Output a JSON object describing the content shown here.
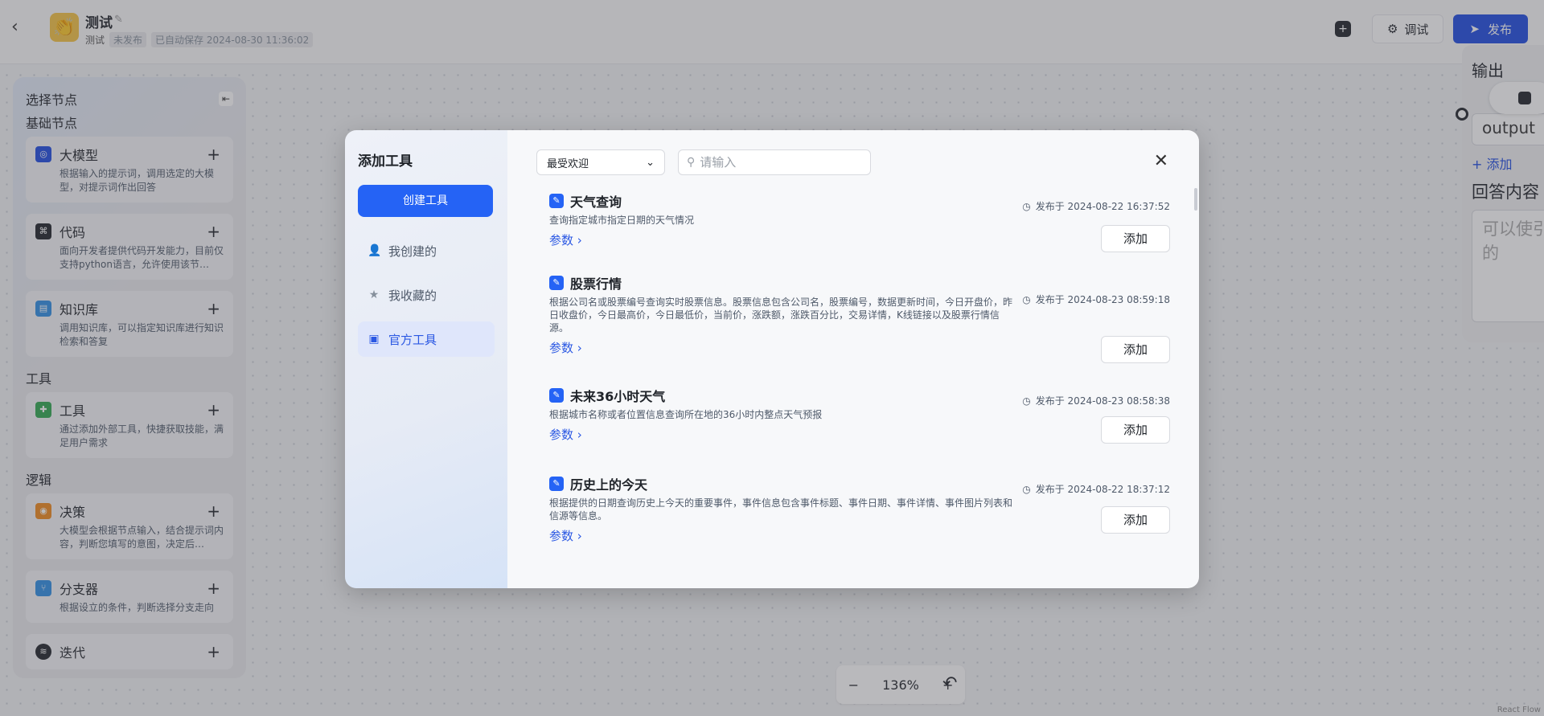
{
  "header": {
    "app_name": "测试",
    "app_desc": "测试",
    "status": "未发布",
    "autosave": "已自动保存 2024-08-30 11:36:02",
    "debug_label": "调试",
    "publish_label": "发布"
  },
  "node_panel": {
    "title": "选择节点",
    "section_basic": "基础节点",
    "section_tools": "工具",
    "section_logic": "逻辑",
    "nodes": [
      {
        "name": "大模型",
        "desc": "根据输入的提示词，调用选定的大模型，对提示词作出回答",
        "color": "#1e4be3"
      },
      {
        "name": "代码",
        "desc": "面向开发者提供代码开发能力，目前仅支持python语言，允许使用该节…",
        "color": "#1f2329"
      },
      {
        "name": "知识库",
        "desc": "调用知识库，可以指定知识库进行知识检索和答复",
        "color": "#2e8ee6"
      },
      {
        "name": "工具",
        "desc": "通过添加外部工具，快捷获取技能，满足用户需求",
        "color": "#2fa84f"
      },
      {
        "name": "决策",
        "desc": "大模型会根据节点输入，结合提示词内容，判断您填写的意图，决定后…",
        "color": "#f08a1c"
      },
      {
        "name": "分支器",
        "desc": "根据设立的条件，判断选择分支走向",
        "color": "#2e8ee6"
      },
      {
        "name": "迭代",
        "desc": "",
        "color": "#1f2329"
      }
    ]
  },
  "right_panel": {
    "title": "输出",
    "field_value": "output",
    "add_label": "添加",
    "answer_label": "回答内容",
    "answer_placeholder": "可以使引}}的"
  },
  "zoom": {
    "minus": "−",
    "level": "136%",
    "plus": "+"
  },
  "canvas_label": "React Flow",
  "modal": {
    "title": "添加工具",
    "create_label": "创建工具",
    "nav": [
      {
        "label": "我创建的",
        "icon": "person-icon"
      },
      {
        "label": "我收藏的",
        "icon": "star-icon"
      },
      {
        "label": "官方工具",
        "icon": "briefcase-icon"
      }
    ],
    "sort_value": "最受欢迎",
    "search_placeholder": "请输入",
    "tools": [
      {
        "name": "天气查询",
        "desc": "查询指定城市指定日期的天气情况",
        "time": "发布于 2024-08-22 16:37:52",
        "params": "参数",
        "add": "添加"
      },
      {
        "name": "股票行情",
        "desc": "根据公司名或股票编号查询实时股票信息。股票信息包含公司名，股票编号，数据更新时间，今日开盘价，昨日收盘价，今日最高价，今日最低价，当前价，涨跌额，涨跌百分比，交易详情，K线链接以及股票行情信源。",
        "time": "发布于 2024-08-23 08:59:18",
        "params": "参数",
        "add": "添加"
      },
      {
        "name": "未来36小时天气",
        "desc": "根据城市名称或者位置信息查询所在地的36小时内整点天气预报",
        "time": "发布于 2024-08-23 08:58:38",
        "params": "参数",
        "add": "添加"
      },
      {
        "name": "历史上的今天",
        "desc": "根据提供的日期查询历史上今天的重要事件，事件信息包含事件标题、事件日期、事件详情、事件图片列表和信源等信息。",
        "time": "发布于 2024-08-22 18:37:12",
        "params": "参数",
        "add": "添加"
      }
    ]
  }
}
